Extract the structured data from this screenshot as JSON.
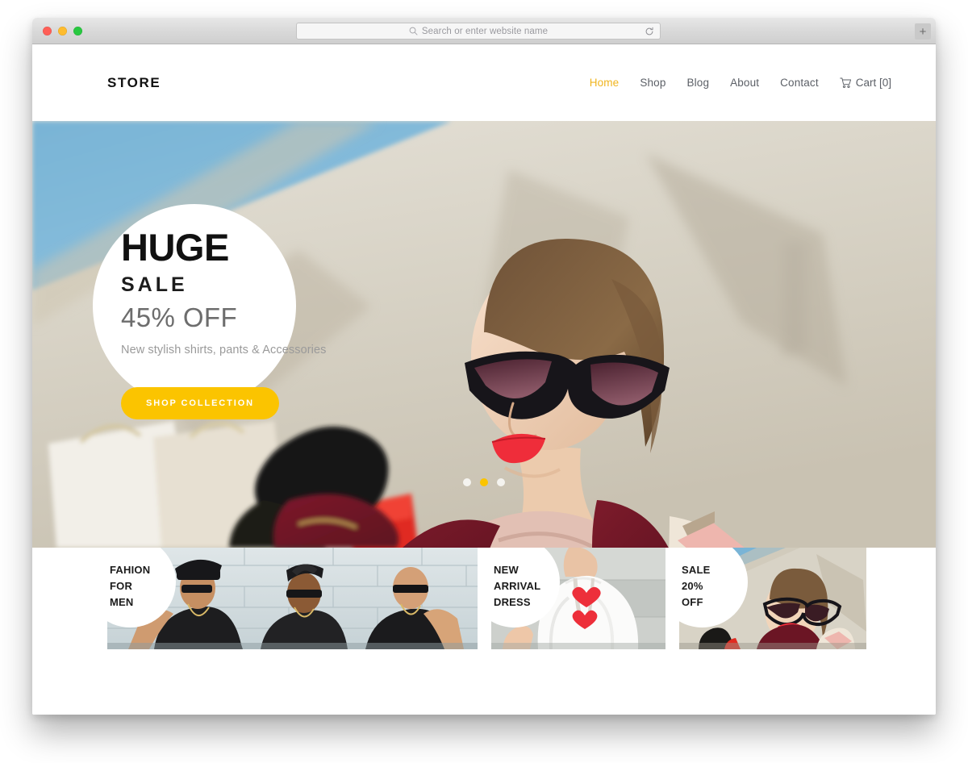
{
  "browser": {
    "search_placeholder": "Search or enter website name",
    "search_icon": "search-icon",
    "reload_icon": "reload-icon",
    "newtab_label": "+",
    "traffic_lights": [
      "close-red",
      "minimize-yellow",
      "maximize-green"
    ]
  },
  "site": {
    "brand": "STORE",
    "nav": [
      {
        "label": "Home",
        "active": true
      },
      {
        "label": "Shop",
        "active": false
      },
      {
        "label": "Blog",
        "active": false
      },
      {
        "label": "About",
        "active": false
      },
      {
        "label": "Contact",
        "active": false
      }
    ],
    "cart": {
      "label": "Cart [0]",
      "icon": "shopping-cart-icon",
      "count": 0
    },
    "hero": {
      "headline": "HUGE",
      "subhead": "SALE",
      "discount": "45% OFF",
      "description": "New stylish shirts, pants & Accessories",
      "cta_label": "SHOP COLLECTION",
      "slides": 3,
      "active_slide": 2
    },
    "cards": [
      {
        "line1": "FAHION",
        "line2": "FOR",
        "line3": "MEN"
      },
      {
        "line1": "NEW",
        "line2": "ARRIVAL",
        "line3": "DRESS"
      },
      {
        "line1": "SALE",
        "line2": "20%",
        "line3": "OFF"
      }
    ],
    "colors": {
      "accent": "#fbc400",
      "nav_active": "#f0b41e",
      "nav_text": "#5b5f66",
      "heading": "#111111"
    }
  }
}
